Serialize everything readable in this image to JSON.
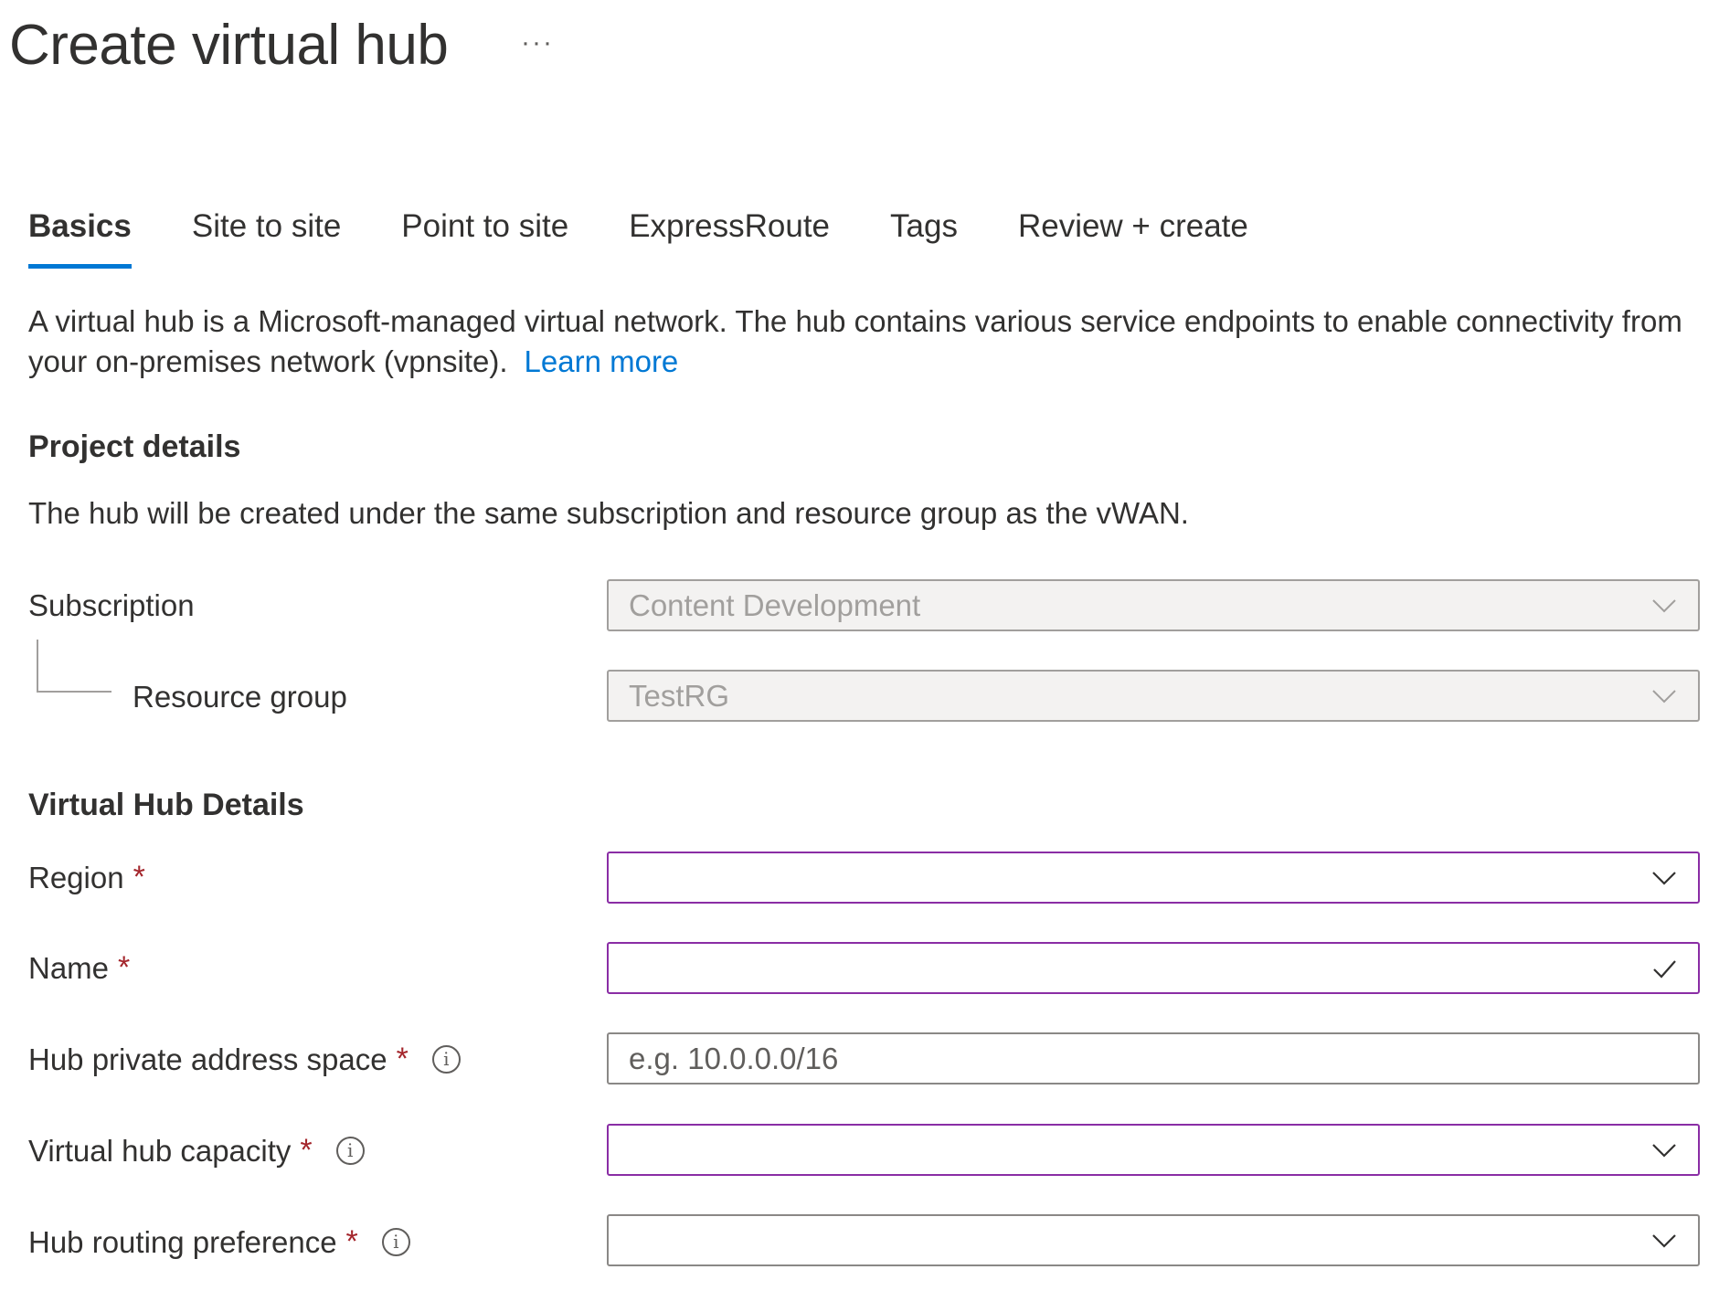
{
  "header": {
    "title": "Create virtual hub",
    "more_label": "···"
  },
  "tabs": [
    {
      "label": "Basics",
      "active": true
    },
    {
      "label": "Site to site",
      "active": false
    },
    {
      "label": "Point to site",
      "active": false
    },
    {
      "label": "ExpressRoute",
      "active": false
    },
    {
      "label": "Tags",
      "active": false
    },
    {
      "label": "Review + create",
      "active": false
    }
  ],
  "intro": {
    "line1": "A virtual hub is a Microsoft-managed virtual network. The hub contains various service endpoints to enable connectivity from",
    "line2": "your on-premises network (vpnsite).",
    "link": "Learn more"
  },
  "project": {
    "heading": "Project details",
    "description": "The hub will be created under the same subscription and resource group as the vWAN.",
    "subscription": {
      "label": "Subscription",
      "value": "Content Development",
      "icon": "chevron-down-icon"
    },
    "resource_group": {
      "label": "Resource group",
      "value": "TestRG",
      "icon": "chevron-down-icon"
    }
  },
  "hub_details": {
    "heading": "Virtual Hub Details",
    "required_marker": "*",
    "info_glyph": "i",
    "region": {
      "label": "Region",
      "value": "",
      "icon": "chevron-down-icon"
    },
    "name": {
      "label": "Name",
      "value": "",
      "icon": "checkmark-icon"
    },
    "address_space": {
      "label": "Hub private address space",
      "value": "",
      "placeholder": "e.g. 10.0.0.0/16"
    },
    "capacity": {
      "label": "Virtual hub capacity",
      "value": "",
      "icon": "chevron-down-icon"
    },
    "routing_preference": {
      "label": "Hub routing preference",
      "value": "",
      "icon": "chevron-down-icon"
    }
  },
  "colors": {
    "accent": "#0078d4",
    "required": "#a4262c",
    "invalid_border": "#8a2da5",
    "disabled_bg": "#f3f2f1"
  }
}
